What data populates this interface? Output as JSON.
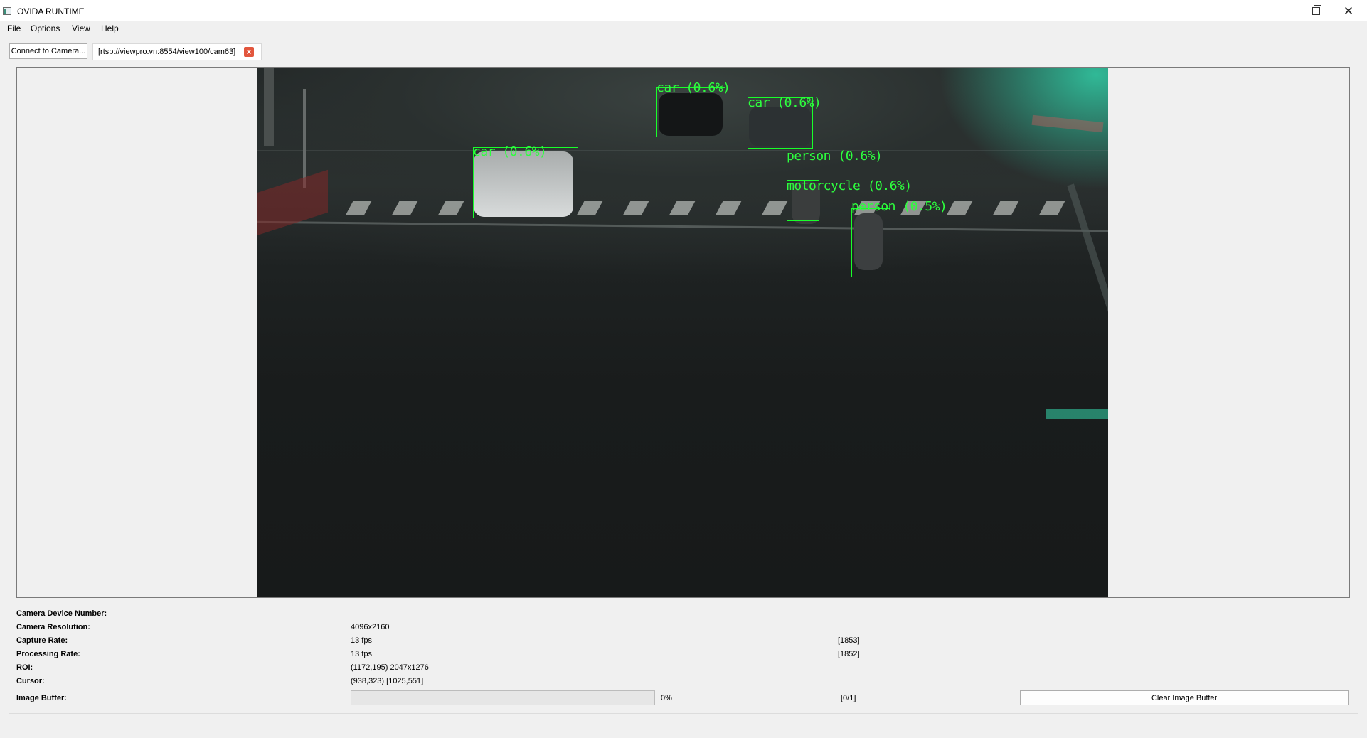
{
  "window": {
    "title": "OVIDA RUNTIME",
    "controls": {
      "minimize_icon": "minimize-icon",
      "maximize_icon": "restore-icon",
      "close_icon": "close-icon"
    }
  },
  "menu": {
    "items": [
      "File",
      "Options",
      "View",
      "Help"
    ]
  },
  "toolbar": {
    "connect_label": "Connect to Camera...",
    "tab_label": "[rtsp://viewpro.vn:8554/view100/cam63]",
    "tab_close_icon": "close-icon",
    "tab_close_color": "#e2563d"
  },
  "video": {
    "detection_color": "#18ff2a",
    "detections": [
      {
        "label": "car (0.6%)"
      },
      {
        "label": "car (0.6%)"
      },
      {
        "label": "car (0.6%)"
      },
      {
        "label": "person (0.6%)"
      },
      {
        "label": "motorcycle (0.6%)"
      },
      {
        "label": "person (0.5%)"
      }
    ]
  },
  "info": {
    "device_number": {
      "label": "Camera Device Number:",
      "value": ""
    },
    "resolution": {
      "label": "Camera Resolution:",
      "value": "4096x2160"
    },
    "capture_rate": {
      "label": "Capture Rate:",
      "value": "13 fps",
      "extra": "[1853]"
    },
    "processing_rate": {
      "label": "Processing Rate:",
      "value": "13 fps",
      "extra": "[1852]"
    },
    "roi": {
      "label": "ROI:",
      "value": "(1172,195) 2047x1276"
    },
    "cursor": {
      "label": "Cursor:",
      "value": "(938,323) [1025,551]"
    },
    "image_buffer": {
      "label": "Image Buffer:",
      "progress": 0,
      "percent_text": "0%",
      "count_text": "[0/1]"
    },
    "clear_label": "Clear Image Buffer"
  }
}
